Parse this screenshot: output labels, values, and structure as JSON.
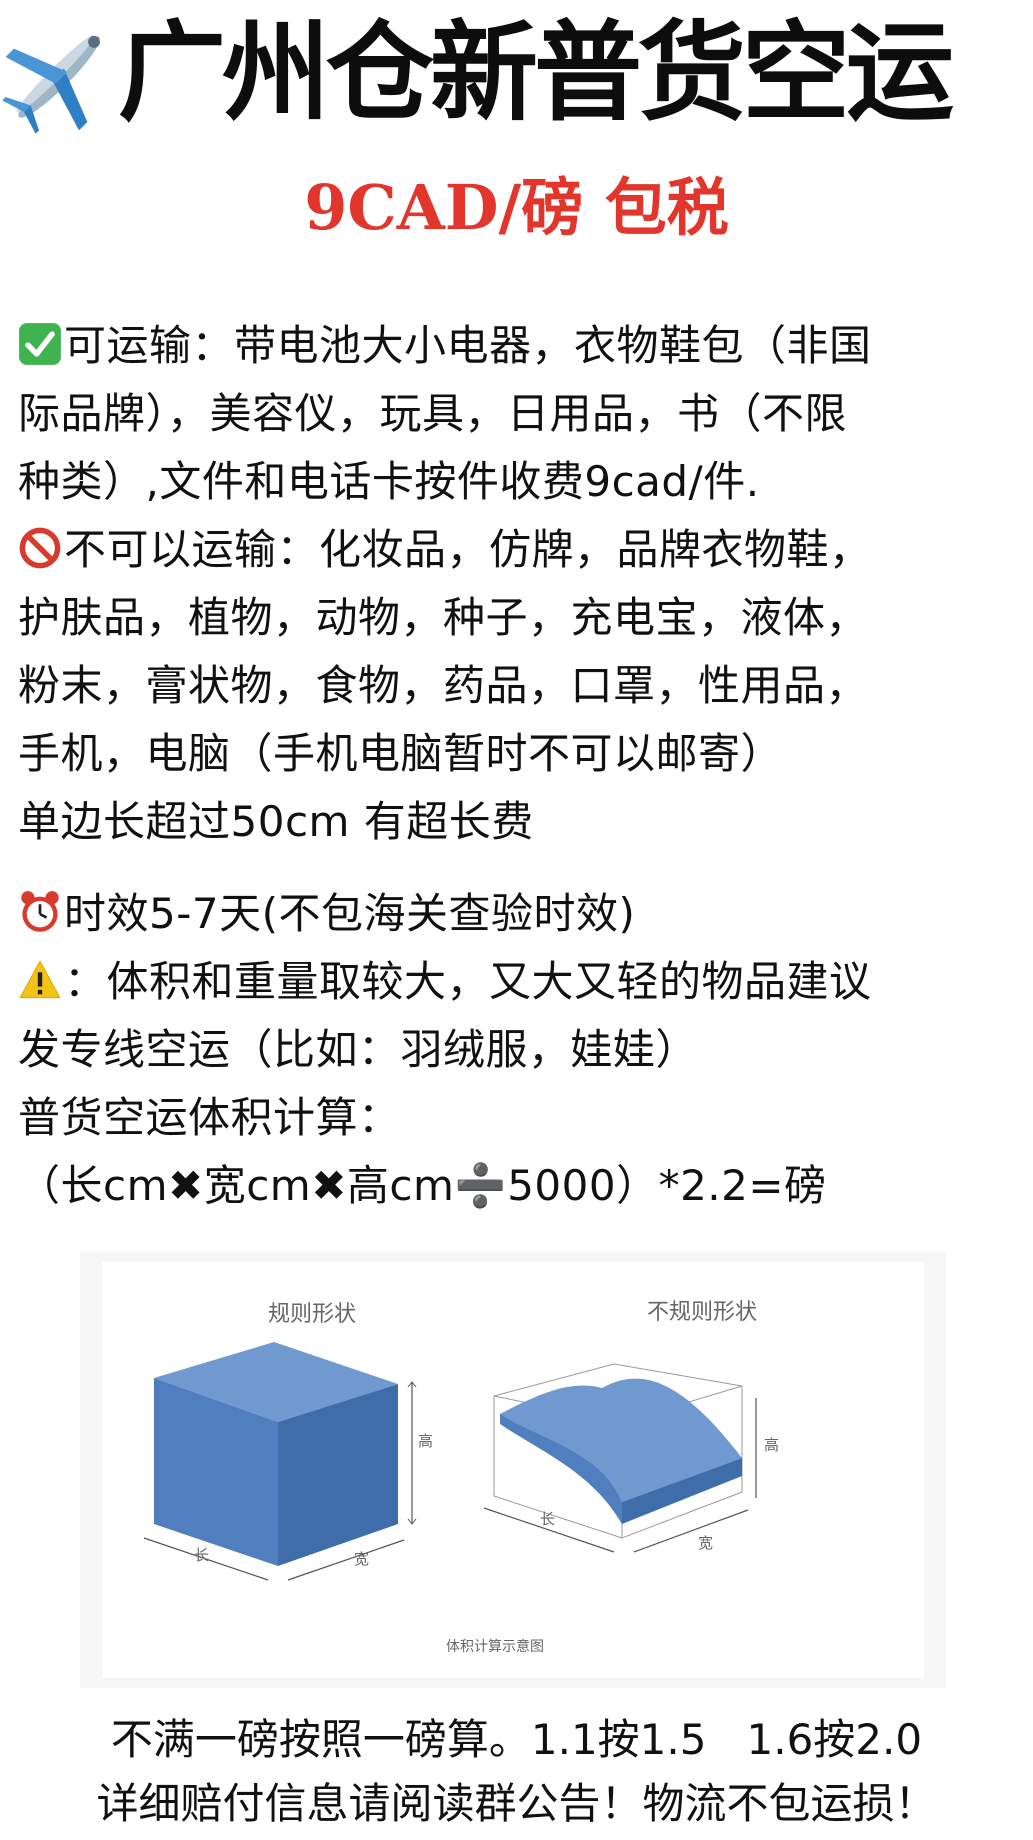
{
  "header": {
    "title": "广州仓新普货空运",
    "subtitle": "9CAD/磅 包税"
  },
  "icons": {
    "plane": "airplane-icon",
    "allowed": "check-mark-icon",
    "prohibited": "prohibited-icon",
    "time": "alarm-clock-icon",
    "warning": "warning-icon"
  },
  "colors": {
    "subtitle": "#e2362c",
    "check": "#3fb34f",
    "prohibited": "#d83a2e",
    "box": "#4f7fbf"
  },
  "allowed": {
    "text": "可运输：带电池大小电器，衣物鞋包（非国\n际品牌），美容仪，玩具，日用品，书（不限\n种类）,文件和电话卡按件收费9cad/件."
  },
  "prohibited": {
    "text": "不可以运输：化妆品，仿牌，品牌衣物鞋，\n护肤品，植物，动物，种子，充电宝，液体，\n粉末，膏状物，食物，药品，口罩，性用品，\n手机，电脑（手机电脑暂时不可以邮寄）\n单边长超过50cm 有超长费"
  },
  "timing": {
    "text": "时效5-7天(不包海关查验时效)"
  },
  "warning": {
    "text": "：体积和重量取较大，又大又轻的物品建议\n发专线空运（比如：羽绒服，娃娃）\n普货空运体积计算：\n （长cm✖宽cm✖高cm➗5000）*2.2=磅"
  },
  "figure": {
    "left_title": "规则形状",
    "right_title": "不规则形状",
    "length": "长",
    "width": "宽",
    "height": "高",
    "caption": "体积计算示意图"
  },
  "footer": {
    "line1": "不满一磅按照一磅算。1.1按1.5   1.6按2.0",
    "line2": "详细赔付信息请阅读群公告！物流不包运损！"
  }
}
